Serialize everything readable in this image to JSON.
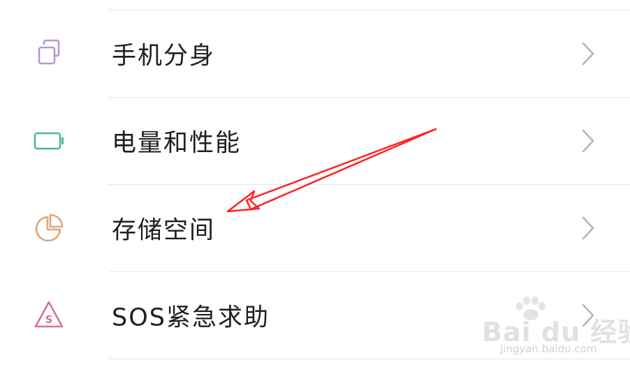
{
  "settings": {
    "items": [
      {
        "label": "手机分身",
        "icon": "clone-icon",
        "icon_color": "#b497d8"
      },
      {
        "label": "电量和性能",
        "icon": "battery-icon",
        "icon_color": "#4cb79b"
      },
      {
        "label": "存储空间",
        "icon": "pie-chart-icon",
        "icon_color": "#e0a678"
      },
      {
        "label": "SOS紧急求助",
        "icon": "sos-triangle-icon",
        "icon_color": "#d9738a",
        "icon_text": "S"
      }
    ],
    "chevron_icon": "chevron-right-icon",
    "chevron_color": "#b5b5b5",
    "divider_color": "#e7e7e7"
  },
  "annotation": {
    "type": "arrow",
    "color": "#ff2222",
    "points_to": "存储空间"
  },
  "watermark": {
    "brand": "Bai du 经验",
    "url": "jingyan.baidu.com"
  }
}
